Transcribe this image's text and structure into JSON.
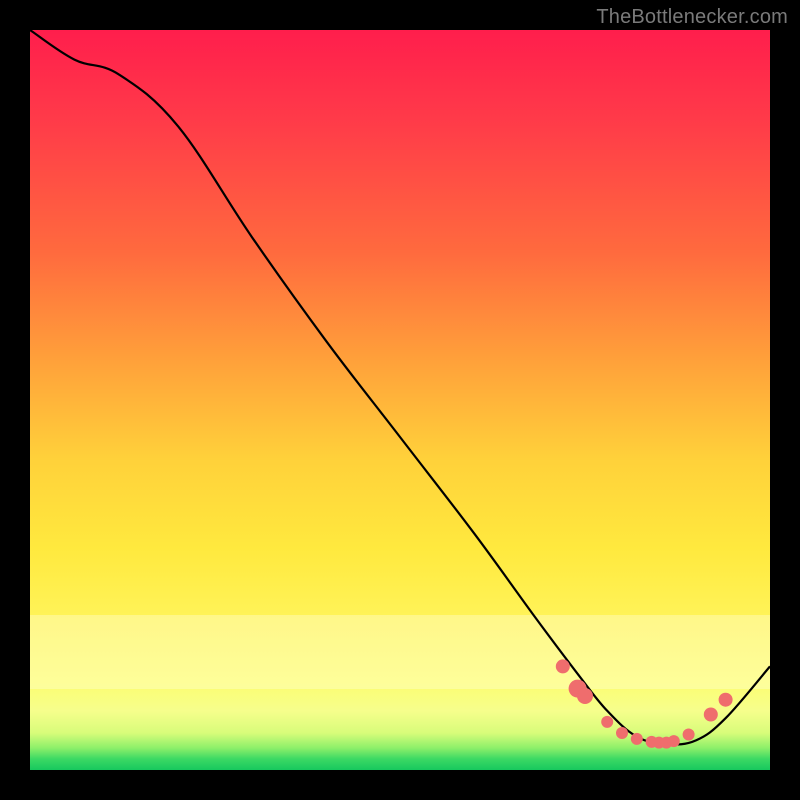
{
  "attribution": "TheBottlenecker.com",
  "chart_data": {
    "type": "line",
    "title": "",
    "xlabel": "",
    "ylabel": "",
    "xlim": [
      0,
      100
    ],
    "ylim": [
      0,
      100
    ],
    "series": [
      {
        "name": "bottleneck-curve",
        "x": [
          0,
          6,
          12,
          20,
          30,
          40,
          50,
          60,
          68,
          74,
          78,
          82,
          86,
          90,
          94,
          100
        ],
        "y_pct_from_top": [
          0,
          4,
          6,
          13,
          28,
          42,
          55,
          68,
          79,
          87,
          92,
          95.5,
          96.5,
          96,
          93,
          86
        ]
      }
    ],
    "markers": {
      "name": "highlight-dots",
      "x": [
        72,
        74,
        75,
        78,
        80,
        82,
        84,
        85,
        86,
        87,
        89,
        92,
        94
      ],
      "y_pct_from_top": [
        86,
        89,
        90,
        93.5,
        95,
        95.8,
        96.2,
        96.3,
        96.3,
        96.1,
        95.2,
        92.5,
        90.5
      ],
      "radius": [
        7,
        9,
        8,
        6,
        6,
        6,
        6,
        6,
        6,
        6,
        6,
        7,
        7
      ]
    },
    "note": "Axes are unlabeled in the image; x and y are expressed as 0–100% of the plot area. y_pct_from_top is distance from the TOP edge (so larger = lower on screen)."
  },
  "colors": {
    "background": "#000000",
    "curve": "#000000",
    "dots": "#ef6d6d",
    "attribution_text": "#7a7a7a"
  }
}
